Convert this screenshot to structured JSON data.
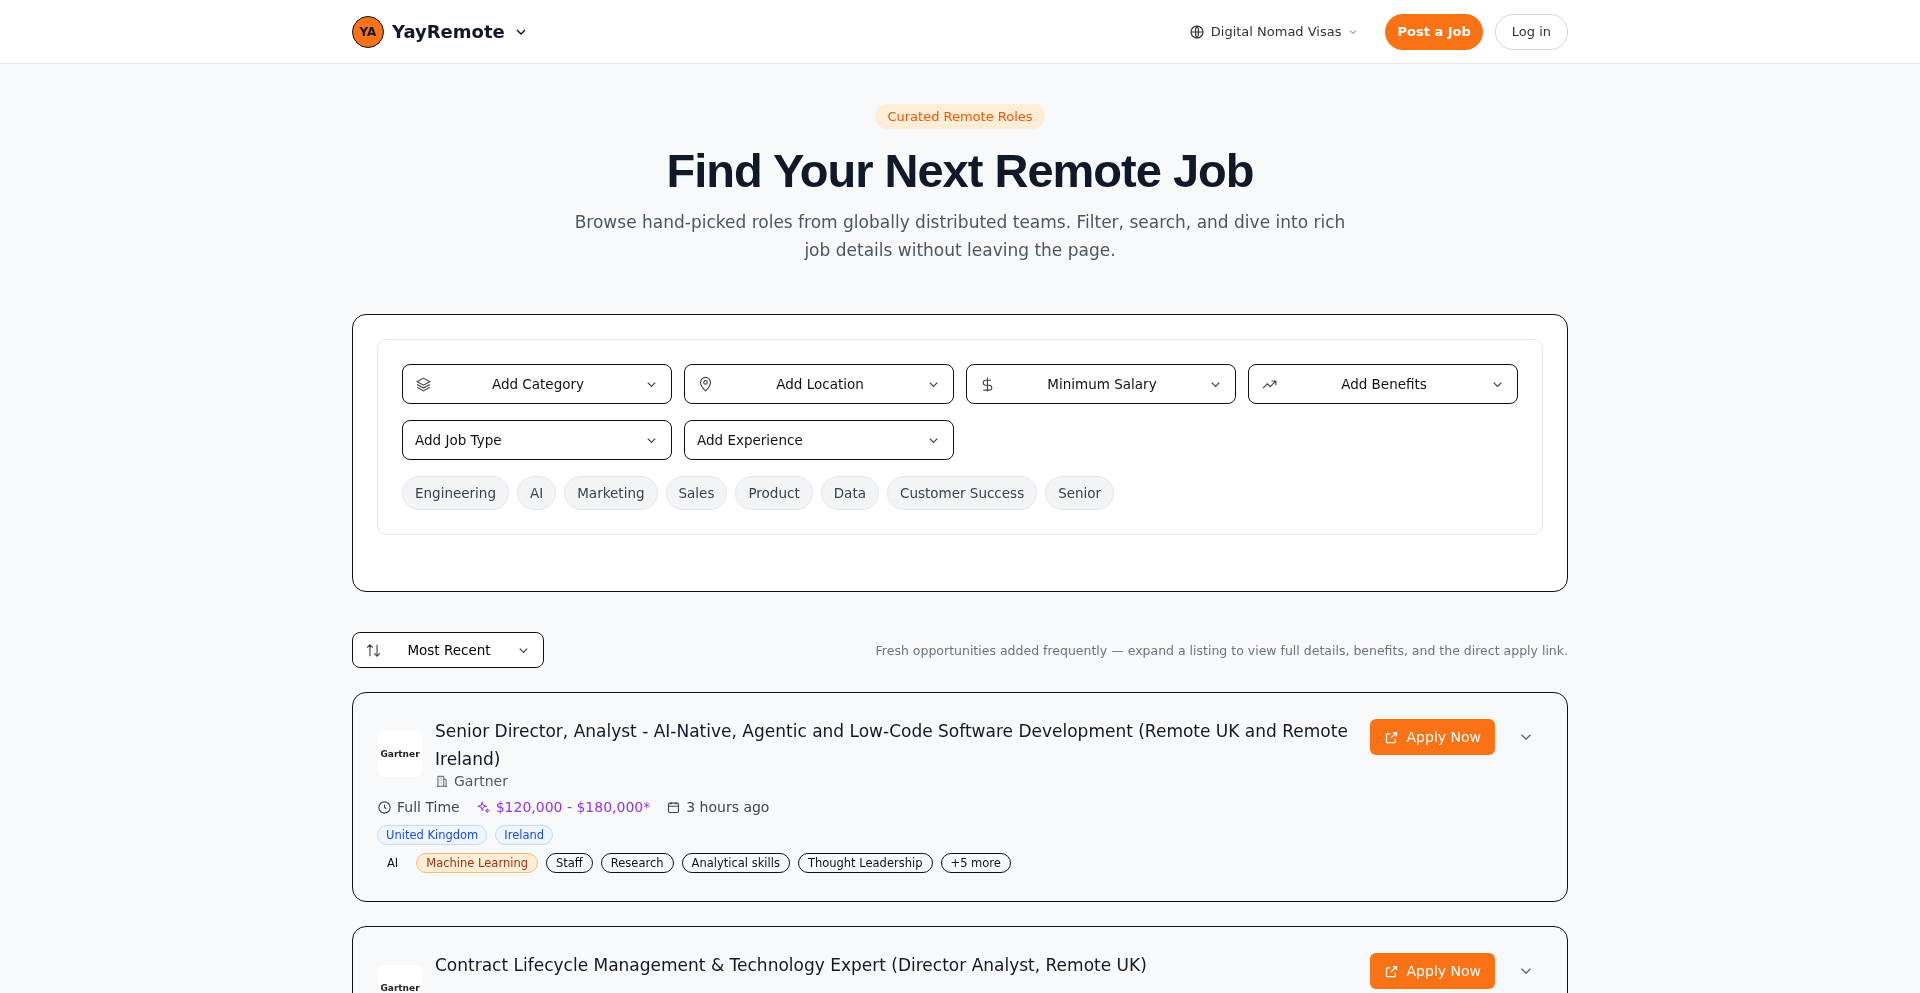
{
  "header": {
    "logo_initials": "YA",
    "brand": "YayRemote",
    "nav_link": "Digital Nomad Visas",
    "post_button": "Post a Job",
    "login_button": "Log in"
  },
  "hero": {
    "badge": "Curated Remote Roles",
    "title": "Find Your Next Remote Job",
    "subtitle": "Browse hand-picked roles from globally distributed teams. Filter, search, and dive into rich job details without leaving the page."
  },
  "filters": [
    "Add Category",
    "Add Location",
    "Minimum Salary",
    "Add Benefits",
    "Add Job Type",
    "Add Experience"
  ],
  "quick_tags": [
    "Engineering",
    "AI",
    "Marketing",
    "Sales",
    "Product",
    "Data",
    "Customer Success",
    "Senior"
  ],
  "sort": {
    "label": "Most Recent"
  },
  "results_note": "Fresh opportunities added frequently — expand a listing to view full details, benefits, and the direct apply link.",
  "jobs": [
    {
      "logo": "Gartner",
      "title": "Senior Director, Analyst - AI-Native, Agentic and Low-Code Software Development (Remote UK and Remote Ireland)",
      "company": "Gartner",
      "job_type": "Full Time",
      "salary": "$120,000 - $180,000*",
      "posted": "3 hours ago",
      "locations": [
        "United Kingdom",
        "Ireland"
      ],
      "tags": [
        {
          "label": "AI",
          "kind": "plain"
        },
        {
          "label": "Machine Learning",
          "kind": "highlight"
        },
        {
          "label": "Staff",
          "kind": "outline"
        },
        {
          "label": "Research",
          "kind": "outline"
        },
        {
          "label": "Analytical skills",
          "kind": "outline"
        },
        {
          "label": "Thought Leadership",
          "kind": "outline"
        },
        {
          "label": "+5 more",
          "kind": "outline"
        }
      ],
      "apply": "Apply Now"
    },
    {
      "logo": "Gartner",
      "title": "Contract Lifecycle Management & Technology Expert (Director Analyst, Remote UK)",
      "apply": "Apply Now"
    }
  ]
}
